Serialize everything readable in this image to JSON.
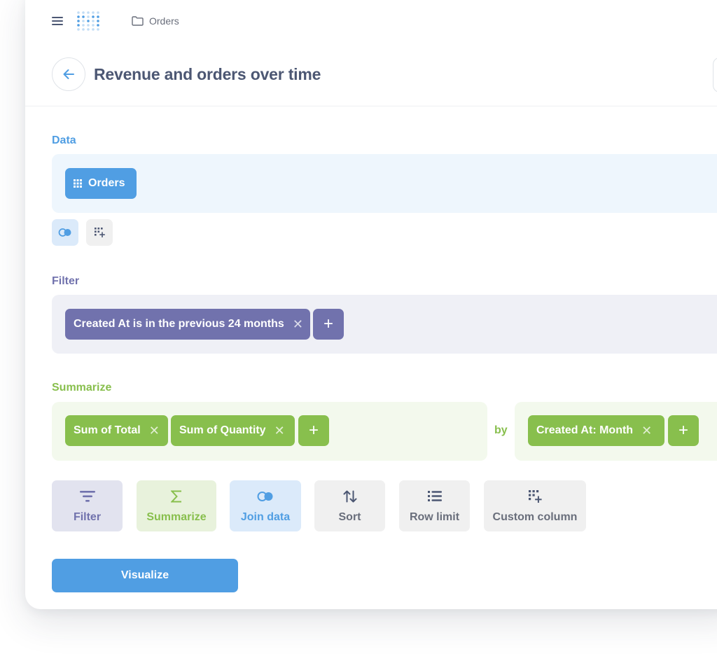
{
  "topbar": {
    "breadcrumb_label": "Orders",
    "menu_icon": "hamburger-menu-icon",
    "logo_icon": "metabase-logo-icon",
    "folder_icon": "folder-icon"
  },
  "header": {
    "title": "Revenue and orders over time",
    "back_icon": "arrow-left-icon"
  },
  "sections": {
    "data": {
      "label": "Data",
      "table_label": "Orders",
      "table_icon": "grid-icon",
      "step_icons": [
        "join-icon",
        "custom-column-icon"
      ]
    },
    "filter": {
      "label": "Filter",
      "items": [
        "Created At is in the previous 24 months"
      ],
      "add_label": "+"
    },
    "summarize": {
      "label": "Summarize",
      "metrics": [
        "Sum of Total",
        "Sum of Quantity"
      ],
      "metrics_add_label": "+",
      "by_label": "by",
      "breakouts": [
        "Created At: Month"
      ],
      "breakouts_add_label": "+"
    }
  },
  "actions": [
    {
      "label": "Filter",
      "icon": "filter-icon"
    },
    {
      "label": "Summarize",
      "icon": "sigma-icon"
    },
    {
      "label": "Join data",
      "icon": "join-icon"
    },
    {
      "label": "Sort",
      "icon": "sort-icon"
    },
    {
      "label": "Row limit",
      "icon": "list-icon"
    },
    {
      "label": "Custom column",
      "icon": "custom-column-icon"
    }
  ],
  "visualize_label": "Visualize",
  "colors": {
    "brand": "#509ee3",
    "filter": "#7172ad",
    "summarize": "#88bf4d",
    "text_dark": "#4c5773",
    "text_medium": "#696e7b"
  }
}
